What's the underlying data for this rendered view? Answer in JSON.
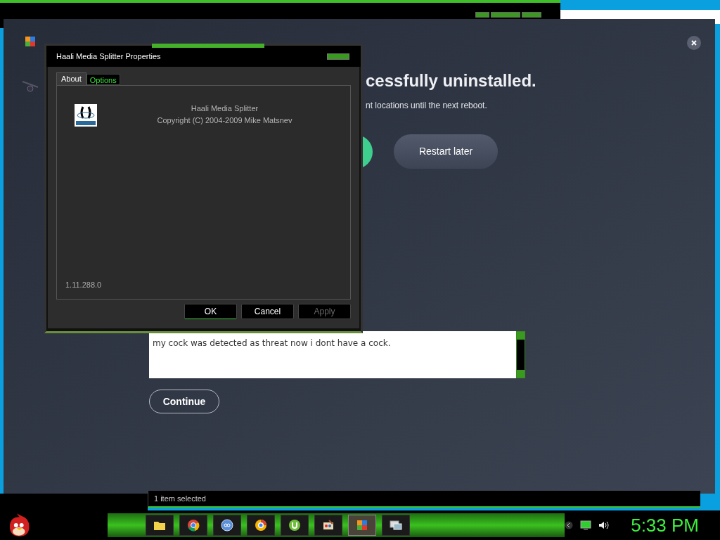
{
  "avg_window": {
    "headline": "cessfully uninstalled.",
    "subtitle": "nt locations until the next reboot.",
    "restart_later": "Restart later",
    "feedback": "my cock was detected as threat now i dont have a cock.",
    "continue": "Continue"
  },
  "dialog": {
    "title": "Haali Media Splitter Properties",
    "tabs": [
      {
        "label": "About",
        "selected": true
      },
      {
        "label": "Options",
        "selected": false
      }
    ],
    "product": "Haali Media Splitter",
    "copyright": "Copyright (C) 2004-2009 Mike Matsnev",
    "version": "1.11.288.0",
    "buttons": [
      {
        "label": "OK",
        "disabled": false,
        "default": true
      },
      {
        "label": "Cancel",
        "disabled": false,
        "default": false
      },
      {
        "label": "Apply",
        "disabled": true,
        "default": false
      }
    ]
  },
  "status_bar": {
    "text": "1 item selected"
  },
  "taskbar": {
    "apps": [
      {
        "kind": "folder",
        "selected": false
      },
      {
        "kind": "chrome",
        "selected": false
      },
      {
        "kind": "qbittorrent",
        "selected": false
      },
      {
        "kind": "browser",
        "selected": false
      },
      {
        "kind": "utorrent",
        "selected": false
      },
      {
        "kind": "paint",
        "selected": false
      },
      {
        "kind": "avg",
        "selected": true
      },
      {
        "kind": "remote",
        "selected": false
      }
    ],
    "clock": "5:33 PM"
  }
}
